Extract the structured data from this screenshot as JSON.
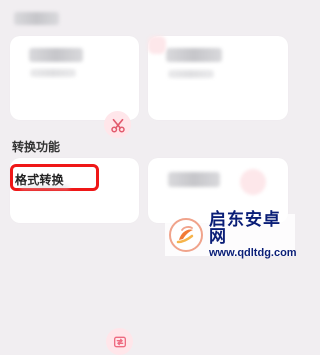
{
  "section": {
    "title": "转换功能"
  },
  "format_convert": {
    "label": "格式转换"
  },
  "watermark": {
    "cn": "启东安卓网",
    "en": "www.qdltdg.com"
  },
  "colors": {
    "accent": "#ef1717",
    "icon_bg": "#ffe6ea",
    "watermark": "#0a1e77"
  }
}
